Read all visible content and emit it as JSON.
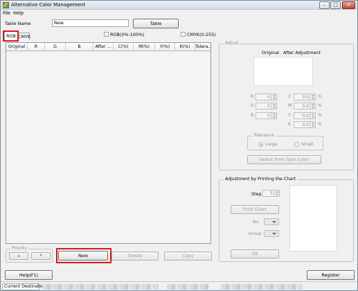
{
  "window": {
    "title": "Alternative Color Management",
    "controls": {
      "minimize": "–",
      "maximize": "□",
      "close": "✕"
    }
  },
  "menu": {
    "file": "File",
    "help": "Help"
  },
  "header": {
    "table_name_label": "Table Name",
    "table_name_value": "New",
    "table_button": "Table"
  },
  "tabs": {
    "rgb": "RGB",
    "cmyk": "CMYK"
  },
  "options": {
    "rgb_percent": "RGB(0%-100%)",
    "cmyk_range": "CMYK(0-255)"
  },
  "grid": {
    "columns": [
      "Original",
      "R",
      "G",
      "B",
      "After ...",
      "C(%)",
      "M(%)",
      "Y(%)",
      "K(%)",
      "Tolera..."
    ]
  },
  "priority": {
    "label": "Priority",
    "up": "▲",
    "down": "▼"
  },
  "actions": {
    "new": "New",
    "delete": "Delete",
    "copy": "Copy"
  },
  "adjust": {
    "label": "Adjust",
    "original_label": "Original",
    "after_label": "After Adjustment",
    "rgb_fields": [
      {
        "name": "R",
        "value": "0"
      },
      {
        "name": "G",
        "value": "0"
      },
      {
        "name": "B",
        "value": "0"
      }
    ],
    "cmyk_fields": [
      {
        "name": "C",
        "value": "0.0",
        "unit": "%"
      },
      {
        "name": "M",
        "value": "0.0",
        "unit": "%"
      },
      {
        "name": "Y",
        "value": "0.0",
        "unit": "%"
      },
      {
        "name": "K",
        "value": "0.0",
        "unit": "%"
      }
    ],
    "tolerance": {
      "label": "Tolerance",
      "large": "Large",
      "small": "Small",
      "selected": "Large"
    },
    "spot_button": "Select from Spot Color"
  },
  "chart_adjust": {
    "label": "Adjustment by Printing the Chart",
    "step_label": "Step",
    "step_value": "5",
    "print_button": "Print Chart",
    "no_label": "No.",
    "group_label": "Group",
    "ok_button": "OK"
  },
  "footer": {
    "help_button": "Help(F1)",
    "register_button": "Register"
  },
  "status": {
    "current_destination_label": "Current Destination"
  }
}
